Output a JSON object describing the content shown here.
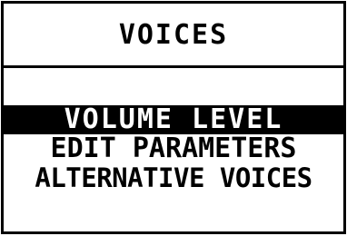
{
  "screen": {
    "title": "VOICES",
    "menu": {
      "items": [
        {
          "label": "VOLUME LEVEL",
          "selected": true
        },
        {
          "label": "EDIT PARAMETERS",
          "selected": false
        },
        {
          "label": "ALTERNATIVE VOICES",
          "selected": false
        }
      ]
    }
  },
  "colors": {
    "foreground": "#000000",
    "background": "#ffffff",
    "selection_bg": "#000000",
    "selection_fg": "#ffffff"
  }
}
